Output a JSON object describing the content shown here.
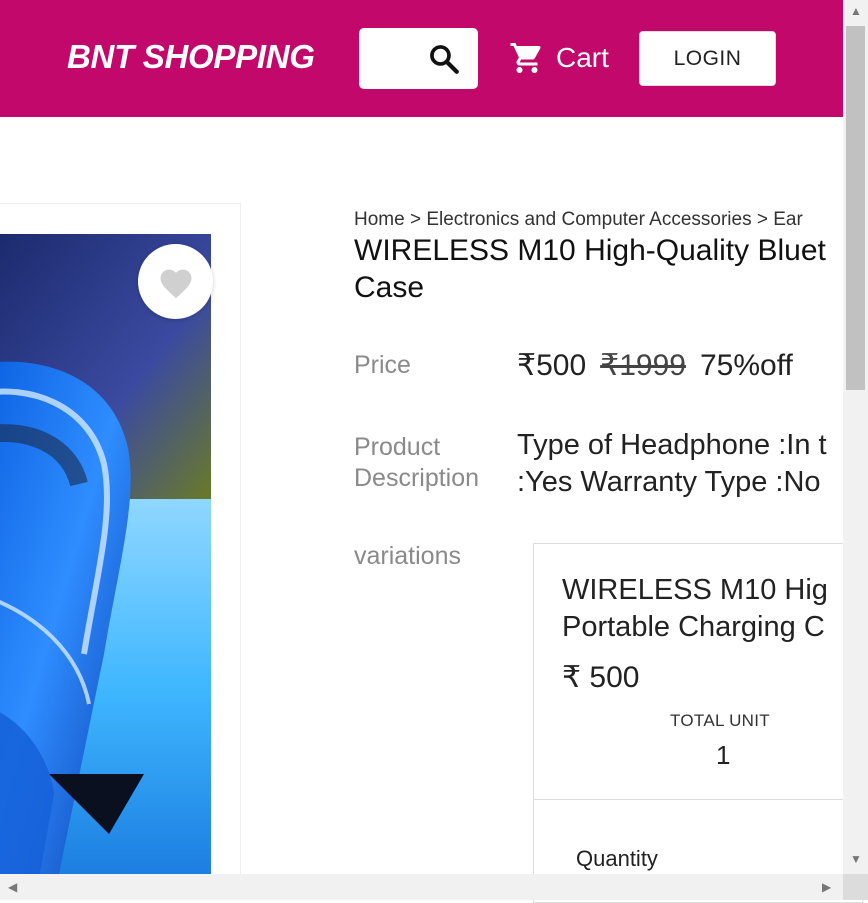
{
  "header": {
    "brand": "BNT SHOPPING",
    "cart_label": "Cart",
    "login_label": "LOGIN",
    "background_color": "#c2086a"
  },
  "icons": {
    "search": "search-icon",
    "cart": "cart-icon",
    "favorite": "heart-icon"
  },
  "product": {
    "breadcrumb": "Home > Electronics and Computer Accessories > Ear",
    "title_line1": "WIRELESS M10 High-Quality Bluet",
    "title_line2": "Case",
    "price_label": "Price",
    "price": "₹500",
    "original_price": "₹1999",
    "discount": "75%off",
    "description_label_line1": "Product",
    "description_label_line2": "Description",
    "description_line1": "Type of Headphone :In t",
    "description_line2": ":Yes Warranty Type :No",
    "variations_label": "variations"
  },
  "variation": {
    "name_line1": "WIRELESS M10 Hig",
    "name_line2": "Portable Charging C",
    "price": "₹ 500",
    "total_unit_label": "TOTAL UNIT",
    "total_unit_value": "1",
    "quantity_label": "Quantity"
  }
}
